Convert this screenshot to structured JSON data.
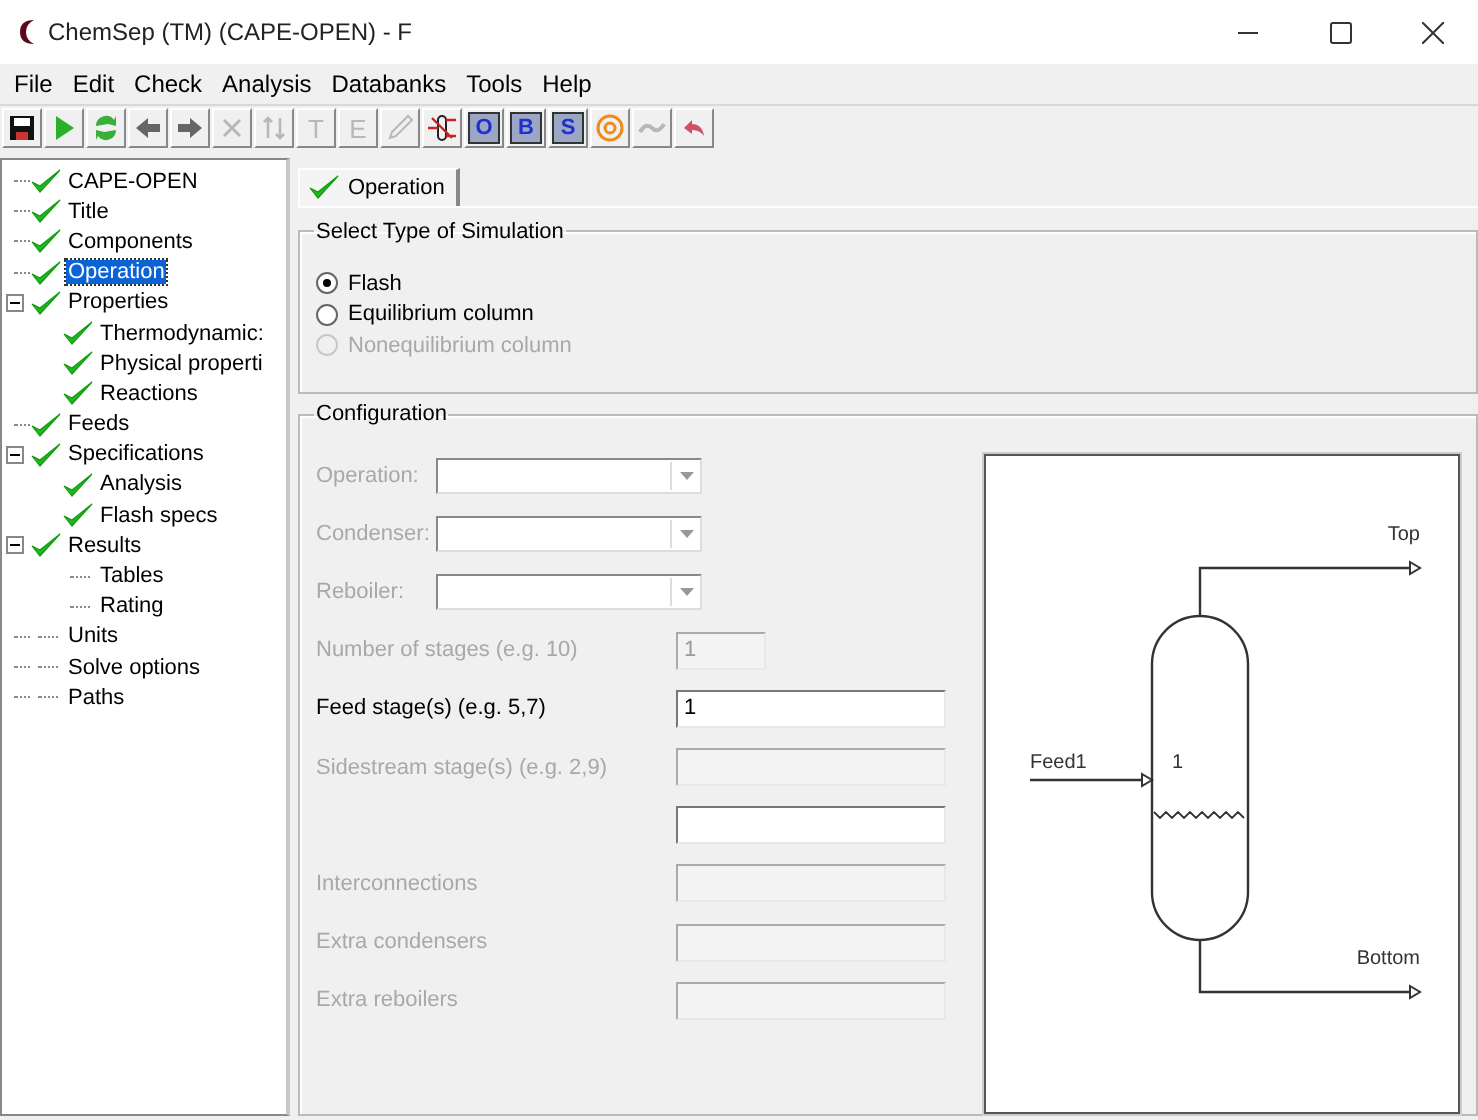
{
  "window": {
    "title": "ChemSep (TM) (CAPE-OPEN) - F"
  },
  "menu": [
    "File",
    "Edit",
    "Check",
    "Analysis",
    "Databanks",
    "Tools",
    "Help"
  ],
  "toolbar": [
    {
      "kind": "save",
      "disabled": false
    },
    {
      "kind": "run",
      "disabled": false
    },
    {
      "kind": "refresh",
      "disabled": false
    },
    {
      "kind": "back",
      "disabled": false
    },
    {
      "kind": "forward",
      "disabled": false
    },
    {
      "kind": "delete",
      "disabled": true
    },
    {
      "kind": "sort",
      "disabled": true
    },
    {
      "kind": "letter",
      "label": "T",
      "disabled": true
    },
    {
      "kind": "letter",
      "label": "E",
      "disabled": true
    },
    {
      "kind": "pencil",
      "disabled": true
    },
    {
      "kind": "component",
      "disabled": false
    },
    {
      "kind": "letterbox",
      "label": "O",
      "disabled": false
    },
    {
      "kind": "letterbox",
      "label": "B",
      "disabled": false
    },
    {
      "kind": "letterbox",
      "label": "S",
      "disabled": false
    },
    {
      "kind": "target",
      "disabled": false
    },
    {
      "kind": "wave",
      "disabled": true
    },
    {
      "kind": "undo",
      "disabled": false
    }
  ],
  "tree": [
    {
      "label": "CAPE-OPEN",
      "checked": true,
      "selected": false
    },
    {
      "label": "Title",
      "checked": true,
      "selected": false
    },
    {
      "label": "Components",
      "checked": true,
      "selected": false
    },
    {
      "label": "Operation",
      "checked": true,
      "selected": true
    },
    {
      "label": "Properties",
      "checked": true,
      "selected": false,
      "expanded": true,
      "children": [
        {
          "label": "Thermodynamic:",
          "checked": true,
          "selected": false
        },
        {
          "label": "Physical properti",
          "checked": true,
          "selected": false
        },
        {
          "label": "Reactions",
          "checked": true,
          "selected": false
        }
      ]
    },
    {
      "label": "Feeds",
      "checked": true,
      "selected": false
    },
    {
      "label": "Specifications",
      "checked": true,
      "selected": false,
      "expanded": true,
      "children": [
        {
          "label": "Analysis",
          "checked": true,
          "selected": false
        },
        {
          "label": "Flash specs",
          "checked": true,
          "selected": false
        }
      ]
    },
    {
      "label": "Results",
      "checked": true,
      "selected": false,
      "expanded": true,
      "children": [
        {
          "label": "Tables",
          "checked": false,
          "selected": false
        },
        {
          "label": "Rating",
          "checked": false,
          "selected": false
        }
      ]
    },
    {
      "label": "Units",
      "checked": false,
      "selected": false
    },
    {
      "label": "Solve options",
      "checked": false,
      "selected": false
    },
    {
      "label": "Paths",
      "checked": false,
      "selected": false
    }
  ],
  "tabs": [
    {
      "label": "Operation",
      "checked": true,
      "selected": true
    }
  ],
  "simulation_type": {
    "title": "Select Type of Simulation",
    "options": [
      {
        "label": "Flash",
        "selected": true,
        "disabled": false
      },
      {
        "label": "Equilibrium column",
        "selected": false,
        "disabled": false
      },
      {
        "label": "Nonequilibrium column",
        "selected": false,
        "disabled": true
      }
    ]
  },
  "configuration": {
    "title": "Configuration",
    "dropdowns": [
      {
        "label": "Operation:",
        "disabled": true
      },
      {
        "label": "Condenser:",
        "disabled": true
      },
      {
        "label": "Reboiler:",
        "disabled": true
      }
    ],
    "fields": [
      {
        "kind": "short",
        "label": "Number of stages (e.g. 10)",
        "value": "1",
        "disabled": true
      },
      {
        "kind": "wide",
        "label": "Feed stage(s) (e.g. 5,7)",
        "value": "1",
        "disabled": false
      },
      {
        "kind": "wide",
        "label": "Sidestream stage(s) (e.g. 2,9)",
        "disabled": true
      },
      {
        "kind": "wide",
        "disabled": false
      },
      {
        "kind": "wide",
        "label": "Interconnections",
        "disabled": true
      },
      {
        "kind": "wide",
        "label": "Extra condensers",
        "disabled": true
      },
      {
        "kind": "wide",
        "label": "Extra reboilers",
        "disabled": true
      }
    ],
    "diagram": {
      "feed": "Feed1",
      "stage": "1",
      "top": "Top",
      "bottom": "Bottom"
    }
  }
}
